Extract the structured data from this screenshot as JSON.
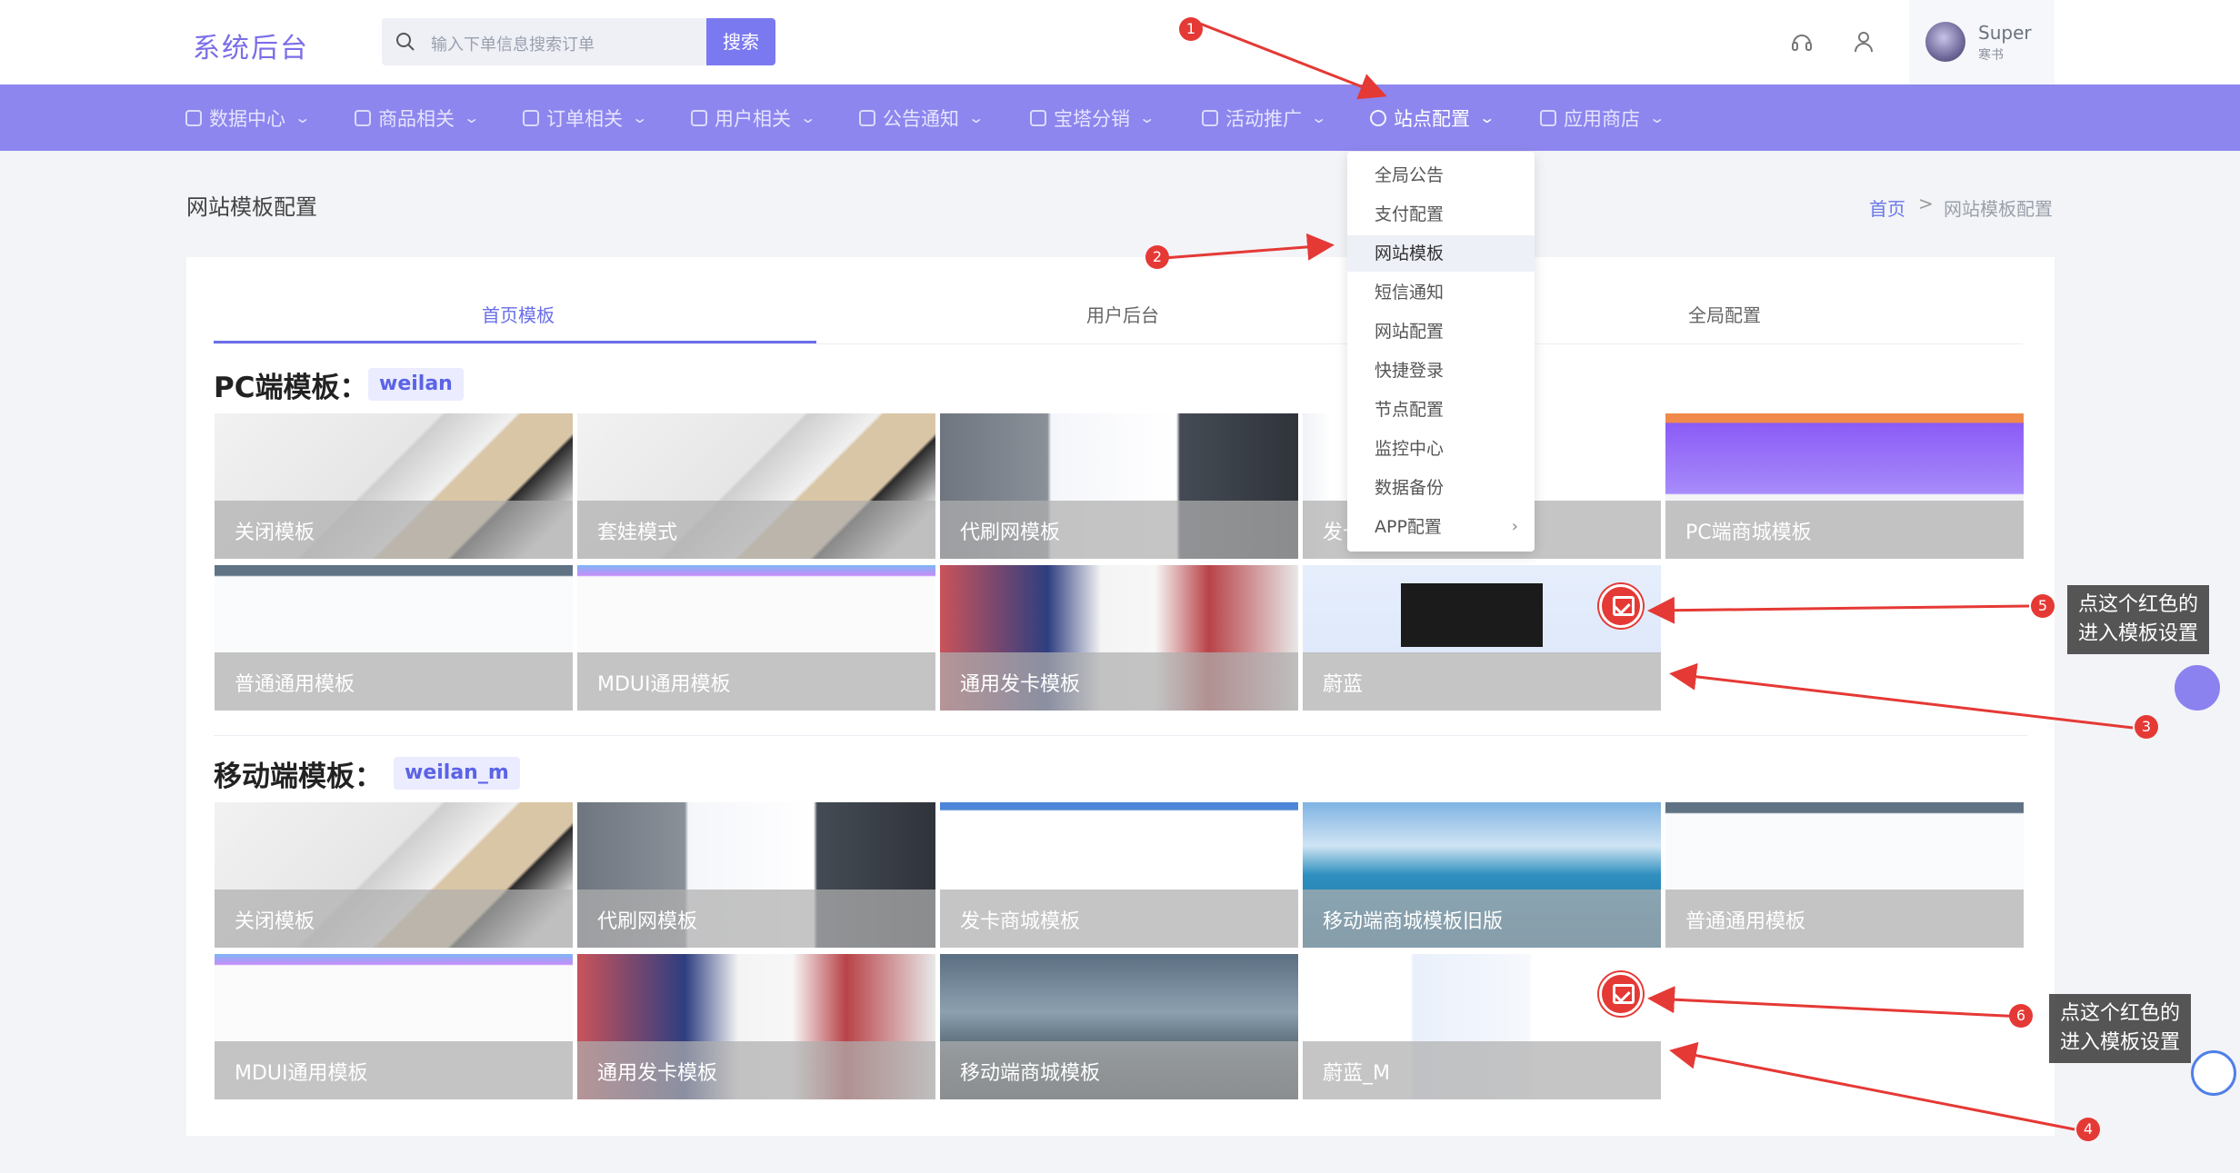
{
  "header": {
    "logo": "系统后台",
    "search_placeholder": "输入下单信息搜索订单",
    "search_button": "搜索",
    "user_name": "Super",
    "user_sub": "寒书"
  },
  "nav": {
    "items": [
      {
        "label": "数据中心",
        "icon": "dashboard-icon"
      },
      {
        "label": "商品相关",
        "icon": "grid-icon"
      },
      {
        "label": "订单相关",
        "icon": "order-icon"
      },
      {
        "label": "用户相关",
        "icon": "user-icon"
      },
      {
        "label": "公告通知",
        "icon": "bus-icon"
      },
      {
        "label": "宝塔分销",
        "icon": "share-icon"
      },
      {
        "label": "活动推广",
        "icon": "gift-icon"
      },
      {
        "label": "站点配置",
        "icon": "gear-icon",
        "active": true
      },
      {
        "label": "应用商店",
        "icon": "cube-icon"
      }
    ]
  },
  "dropdown": {
    "items": [
      "全局公告",
      "支付配置",
      "网站模板",
      "短信通知",
      "网站配置",
      "快捷登录",
      "节点配置",
      "监控中心",
      "数据备份",
      "APP配置"
    ],
    "selected": "网站模板",
    "submenu_arrow": "›"
  },
  "page": {
    "title": "网站模板配置",
    "breadcrumb_home": "首页",
    "breadcrumb_sep": ">",
    "breadcrumb_current": "网站模板配置"
  },
  "tabs": [
    "首页模板",
    "用户后台",
    "全局配置"
  ],
  "pc": {
    "title": "PC端模板：",
    "tag": "weilan",
    "templates": [
      "关闭模板",
      "套娃模式",
      "代刷网模板",
      "发卡商城模板",
      "PC端商城模板",
      "普通通用模板",
      "MDUI通用模板",
      "通用发卡模板",
      "蔚蓝"
    ]
  },
  "mobile": {
    "title": "移动端模板：",
    "tag": "weilan_m",
    "templates": [
      "关闭模板",
      "代刷网模板",
      "发卡商城模板",
      "移动端商城模板旧版",
      "普通通用模板",
      "MDUI通用模板",
      "通用发卡模板",
      "移动端商城模板",
      "蔚蓝_M"
    ]
  },
  "annotations": {
    "badges": [
      "1",
      "2",
      "3",
      "4",
      "5",
      "6"
    ],
    "tip5": "点这个红色的\n进入模板设置",
    "tip6": "点这个红色的\n进入模板设置",
    "tip5_l1": "点这个红色的",
    "tip5_l2": "进入模板设置",
    "tip6_l1": "点这个红色的",
    "tip6_l2": "进入模板设置"
  },
  "colors": {
    "accent": "#8d86ee",
    "brand": "#7a6ee8",
    "annotation": "#e53935"
  }
}
